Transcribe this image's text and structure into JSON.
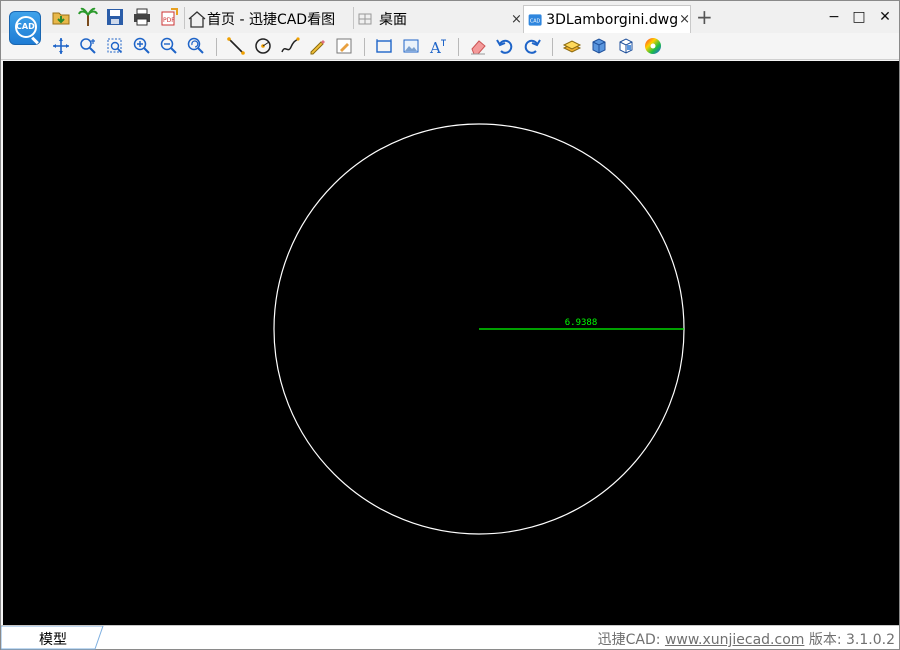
{
  "window": {
    "minimize_glyph": "−",
    "maximize_glyph": "□",
    "close_glyph": "✕"
  },
  "logo": {
    "text": "CAD"
  },
  "tabs": [
    {
      "label": "首页 - 迅捷CAD看图",
      "icon": "home-icon",
      "active": false,
      "closable": false
    },
    {
      "label": "桌面",
      "icon": "grid-icon",
      "active": false,
      "closable": true
    },
    {
      "label": "3DLamborgini.dwg",
      "icon": "cad-file-icon",
      "active": true,
      "closable": true
    }
  ],
  "tab_close_glyph": "×",
  "add_tab_glyph": "+",
  "quick_access": [
    "open-folder-icon",
    "palm-tree-icon",
    "save-icon",
    "print-icon",
    "export-pdf-icon"
  ],
  "toolbar": {
    "groups": [
      [
        "pan-icon",
        "zoom-realtime-icon",
        "zoom-window-icon",
        "zoom-in-icon",
        "zoom-out-icon",
        "zoom-previous-icon"
      ],
      [
        "line-icon",
        "circle-measure-icon",
        "polyline-icon",
        "pencil-icon",
        "eraser-brush-icon"
      ],
      [
        "frame-icon",
        "image-icon",
        "text-icon"
      ],
      [
        "eraser-icon",
        "undo-icon",
        "redo-icon"
      ],
      [
        "layers-icon",
        "3d-box-icon",
        "3d-view-icon",
        "color-wheel-icon"
      ]
    ]
  },
  "drawing": {
    "background": "#000000",
    "circle_color": "#ffffff",
    "dimension_color": "#00ff00",
    "dimension_text": "6.9388"
  },
  "statusbar": {
    "model_tab": "模型",
    "version_prefix": "迅捷CAD: ",
    "version_link": "www.xunjiecad.com",
    "version_suffix": " 版本: 3.1.0.2"
  }
}
